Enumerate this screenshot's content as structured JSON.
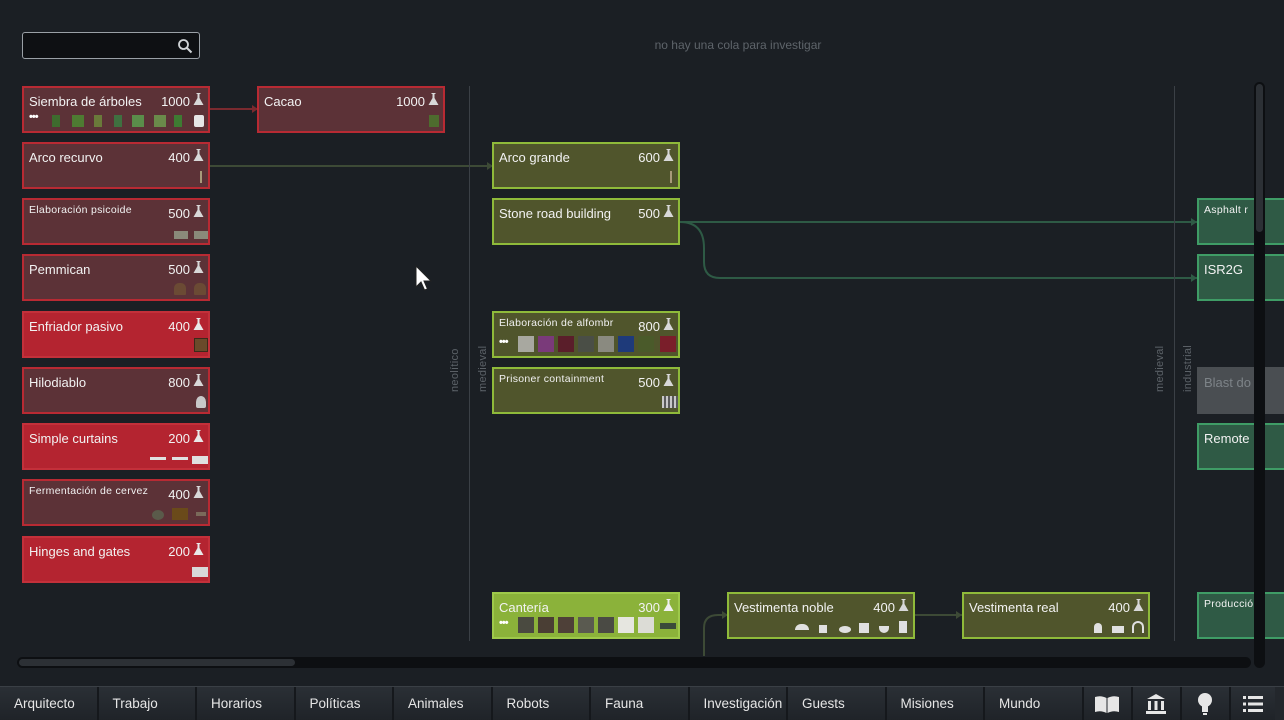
{
  "search": {
    "placeholder": ""
  },
  "queue_message": "no hay una cola para investigar",
  "eras": [
    "neolítico",
    "medieval",
    "medieval",
    "industrial"
  ],
  "nodes": [
    {
      "label": "Siembra de árboles",
      "cost": "1000",
      "style": "red"
    },
    {
      "label": "Cacao",
      "cost": "1000",
      "style": "red"
    },
    {
      "label": "Arco recurvo",
      "cost": "400",
      "style": "red"
    },
    {
      "label": "Elaboración psicoide",
      "cost": "500",
      "style": "red"
    },
    {
      "label": "Pemmican",
      "cost": "500",
      "style": "red"
    },
    {
      "label": "Enfriador pasivo",
      "cost": "400",
      "style": "red-bright"
    },
    {
      "label": "Hilodiablo",
      "cost": "800",
      "style": "red"
    },
    {
      "label": "Simple curtains",
      "cost": "200",
      "style": "red-bright"
    },
    {
      "label": "Fermentación de cervez",
      "cost": "400",
      "style": "red"
    },
    {
      "label": "Hinges and gates",
      "cost": "200",
      "style": "red-bright"
    },
    {
      "label": "Arco grande",
      "cost": "600",
      "style": "olive"
    },
    {
      "label": "Stone road building",
      "cost": "500",
      "style": "olive"
    },
    {
      "label": "Elaboración de alfombr",
      "cost": "800",
      "style": "olive"
    },
    {
      "label": "Prisoner containment",
      "cost": "500",
      "style": "olive"
    },
    {
      "label": "Cantería",
      "cost": "300",
      "style": "lime"
    },
    {
      "label": "Vestimenta noble",
      "cost": "400",
      "style": "olive"
    },
    {
      "label": "Vestimenta real",
      "cost": "400",
      "style": "olive"
    },
    {
      "label": "Asphalt r",
      "cost": "",
      "style": "green"
    },
    {
      "label": "ISR2G",
      "cost": "",
      "style": "green"
    },
    {
      "label": "Blast do",
      "cost": "",
      "style": "grey"
    },
    {
      "label": "Remote",
      "cost": "",
      "style": "green"
    },
    {
      "label": "Producció",
      "cost": "",
      "style": "green"
    }
  ],
  "bottom_tabs": [
    "Arquitecto",
    "Trabajo",
    "Horarios",
    "Políticas",
    "Animales",
    "Robots",
    "Fauna",
    "Investigación",
    "Guests",
    "Misiones",
    "Mundo"
  ],
  "bottom_icons": [
    "book-icon",
    "history-icon",
    "lightbulb-icon",
    "menu-icon"
  ],
  "colors": {
    "unavailable_red": "#5c3237",
    "available_red": "#b42430",
    "olive": "#50552c",
    "selected_lime": "#8bb23a",
    "industrial_green": "#2f5a45"
  }
}
